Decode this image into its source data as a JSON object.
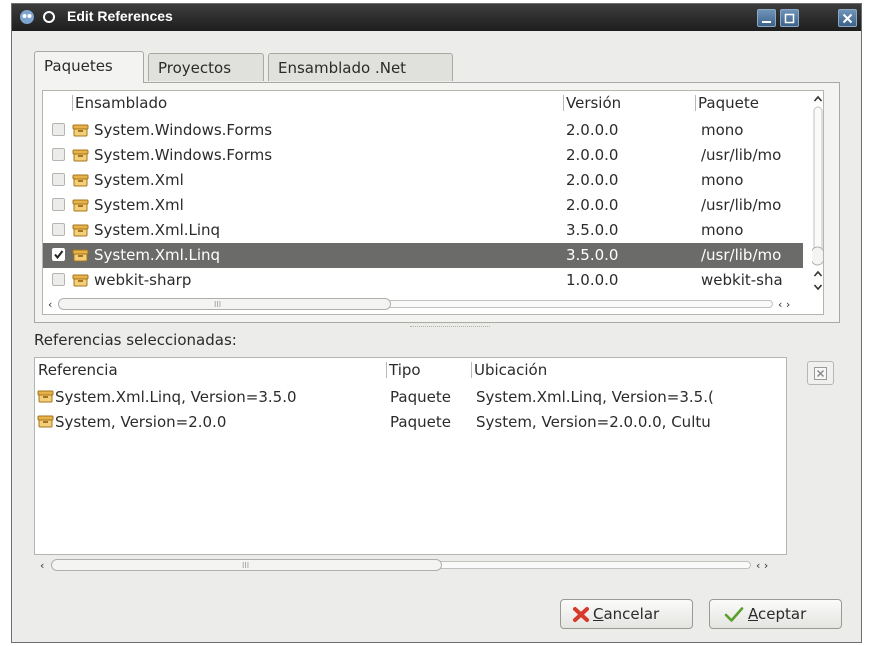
{
  "window": {
    "title": "Edit References"
  },
  "tabs": [
    {
      "label": "Paquetes",
      "active": true
    },
    {
      "label": "Proyectos",
      "active": false
    },
    {
      "label": "Ensamblado .Net",
      "active": false
    }
  ],
  "packages": {
    "columns": {
      "ensamblado": "Ensamblado",
      "version": "Versión",
      "paquete": "Paquete"
    },
    "rows": [
      {
        "name": "System.Windows.Forms",
        "version": "2.0.0.0",
        "package": "mono",
        "checked": false,
        "selected": false
      },
      {
        "name": "System.Windows.Forms",
        "version": "2.0.0.0",
        "package": "/usr/lib/mo",
        "checked": false,
        "selected": false
      },
      {
        "name": "System.Xml",
        "version": "2.0.0.0",
        "package": "mono",
        "checked": false,
        "selected": false
      },
      {
        "name": "System.Xml",
        "version": "2.0.0.0",
        "package": "/usr/lib/mo",
        "checked": false,
        "selected": false
      },
      {
        "name": "System.Xml.Linq",
        "version": "3.5.0.0",
        "package": "mono",
        "checked": false,
        "selected": false
      },
      {
        "name": "System.Xml.Linq",
        "version": "3.5.0.0",
        "package": "/usr/lib/mo",
        "checked": true,
        "selected": true
      },
      {
        "name": "webkit-sharp",
        "version": "1.0.0.0",
        "package": "webkit-sha",
        "checked": false,
        "selected": false
      }
    ]
  },
  "selected_references": {
    "label": "Referencias seleccionadas:",
    "columns": {
      "referencia": "Referencia",
      "tipo": "Tipo",
      "ubicacion": "Ubicación"
    },
    "rows": [
      {
        "reference": "System.Xml.Linq, Version=3.5.0",
        "type": "Paquete",
        "location": "System.Xml.Linq, Version=3.5.("
      },
      {
        "reference": "System, Version=2.0.0",
        "type": "Paquete",
        "location": "System, Version=2.0.0.0, Cultu"
      }
    ]
  },
  "buttons": {
    "cancel": {
      "mnemonic": "C",
      "rest": "ancelar"
    },
    "ok": {
      "mnemonic": "A",
      "rest": "ceptar"
    }
  },
  "colors": {
    "selection": "#6b6b69",
    "titlebar": "#2a2a2a",
    "window_bg": "#ececea"
  },
  "icons": [
    "app-icon",
    "window-menu-icon",
    "minimize-icon",
    "maximize-icon",
    "close-icon",
    "package-icon",
    "remove-reference-icon",
    "cancel-icon",
    "accept-icon"
  ]
}
